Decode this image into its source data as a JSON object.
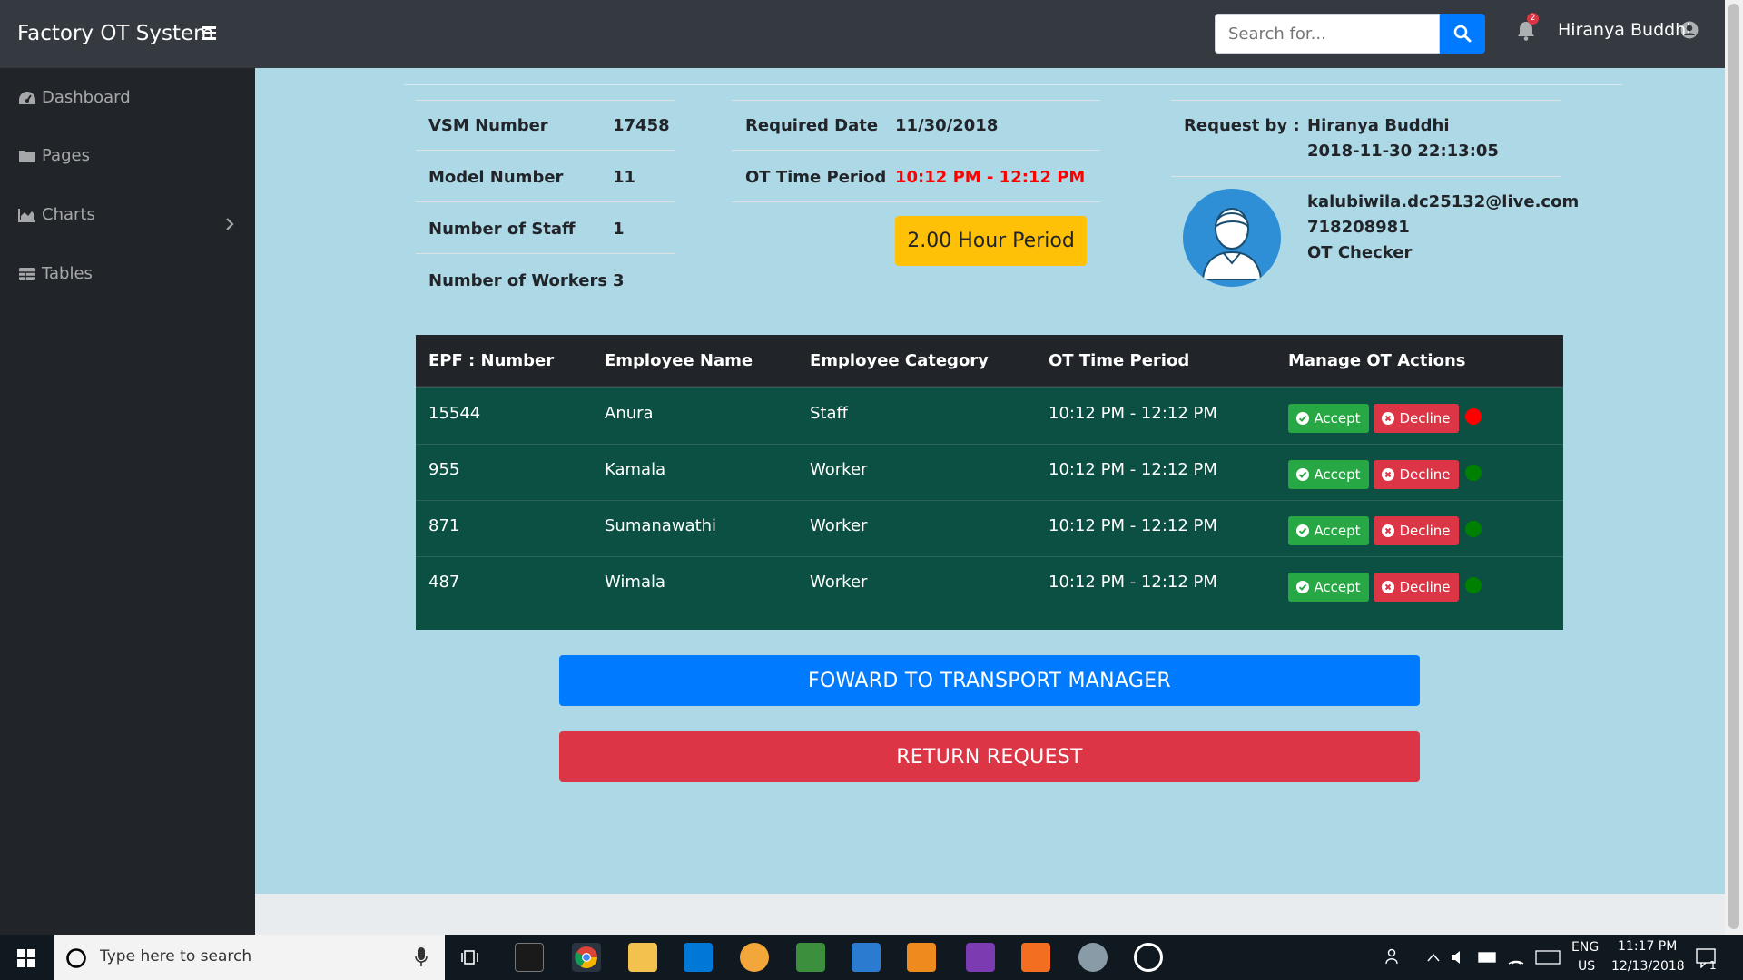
{
  "navbar": {
    "brand": "Factory OT System",
    "search_placeholder": "Search for...",
    "notification_count": "2",
    "user_name": "Hiranya Buddhi"
  },
  "sidebar": {
    "items": [
      {
        "label": "Dashboard",
        "icon": "tachometer-icon"
      },
      {
        "label": "Pages",
        "icon": "folder-icon"
      },
      {
        "label": "Charts",
        "icon": "area-chart-icon"
      },
      {
        "label": "Tables",
        "icon": "table-icon"
      }
    ]
  },
  "request_info": {
    "vsm_label": "VSM Number",
    "vsm_value": "17458",
    "model_label": "Model Number",
    "model_value": "11",
    "staff_label": "Number of Staff",
    "staff_value": "1",
    "workers_label": "Number of Workers",
    "workers_value": "3",
    "date_label": "Required Date",
    "date_value": "11/30/2018",
    "period_label": "OT Time Period",
    "period_value": "10:12 PM - 12:12 PM",
    "hour_badge": "2.00 Hour Period",
    "request_by_label": "Request by :",
    "request_by_name": "Hiranya Buddhi",
    "request_by_time": "2018-11-30 22:13:05",
    "email": "kalubiwila.dc25132@live.com",
    "phone": "718208981",
    "role": "OT Checker"
  },
  "table": {
    "headers": [
      "EPF : Number",
      "Employee Name",
      "Employee Category",
      "OT Time Period",
      "Manage OT Actions"
    ],
    "accept_label": "Accept",
    "decline_label": "Decline",
    "rows": [
      {
        "epf": "15544",
        "name": "Anura",
        "category": "Staff",
        "period": "10:12 PM - 12:12 PM",
        "status_color": "#ff0000"
      },
      {
        "epf": "955",
        "name": "Kamala",
        "category": "Worker",
        "period": "10:12 PM - 12:12 PM",
        "status_color": "#008000"
      },
      {
        "epf": "871",
        "name": "Sumanawathi",
        "category": "Worker",
        "period": "10:12 PM - 12:12 PM",
        "status_color": "#008000"
      },
      {
        "epf": "487",
        "name": "Wimala",
        "category": "Worker",
        "period": "10:12 PM - 12:12 PM",
        "status_color": "#008000"
      }
    ]
  },
  "actions": {
    "forward_label": "FOWARD TO TRANSPORT MANAGER",
    "return_label": "RETURN REQUEST"
  },
  "taskbar": {
    "search_placeholder": "Type here to search",
    "lang_top": "ENG",
    "lang_bottom": "US",
    "time": "11:17 PM",
    "date": "12/13/2018",
    "notification_count": "1"
  },
  "colors": {
    "sidebar_bg": "#212529",
    "main_bg": "#add8e6",
    "table_body": "#0c4f43",
    "primary": "#007bff",
    "danger": "#dc3545",
    "warning": "#ffc107",
    "success": "#28a745"
  }
}
